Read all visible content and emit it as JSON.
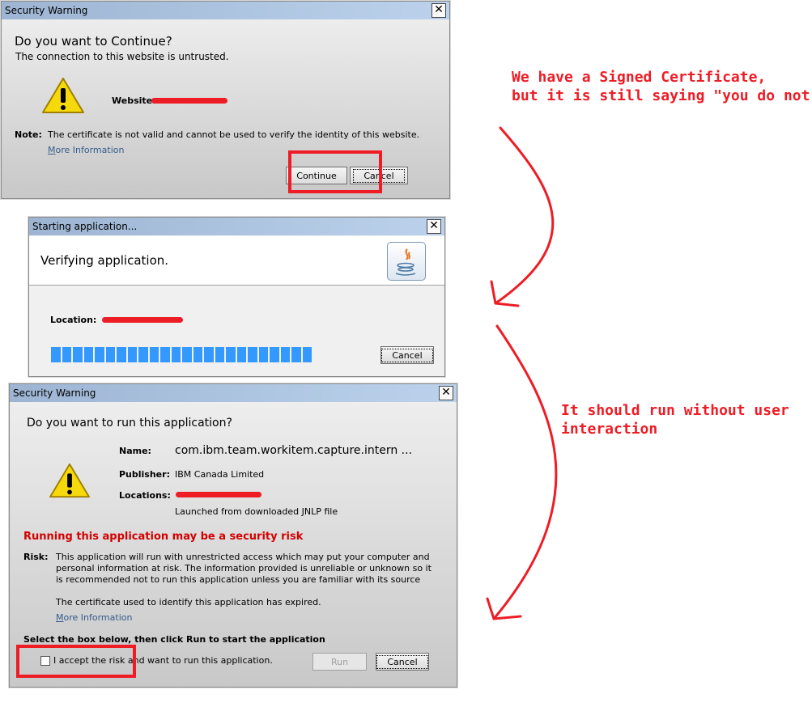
{
  "dialog1": {
    "title": "Security Warning",
    "heading": "Do you want to Continue?",
    "subheading": "The connection to this website is untrusted.",
    "website_label": "Website:",
    "note_label": "Note:",
    "note_text": "The certificate is not valid and cannot be used to verify the identity of this website.",
    "more_info": "More Information",
    "continue_label": "Continue",
    "cancel_label": "Cancel",
    "close_label": "✕"
  },
  "dialog2": {
    "title": "Starting application...",
    "heading": "Verifying application.",
    "location_label": "Location:",
    "cancel_label": "Cancel",
    "close_label": "✕",
    "progress_color": "#3399ff"
  },
  "dialog3": {
    "title": "Security Warning",
    "heading": "Do you want to run this application?",
    "name_label": "Name:",
    "name_value": "com.ibm.team.workitem.capture.intern ...",
    "publisher_label": "Publisher:",
    "publisher_value": "IBM Canada Limited",
    "locations_label": "Locations:",
    "launched_from": "Launched from downloaded JNLP file",
    "risk_heading": "Running this application may be a security risk",
    "risk_label": "Risk:",
    "risk_text": "This application will run with unrestricted access which may put your computer and personal information at risk. The information provided is unreliable or unknown so it is recommended not to run this application unless you are familiar with its source",
    "cert_expired": "The certificate used to identify this application has expired.",
    "more_info": "More Information",
    "select_instruction": "Select the box below, then click Run to start the application",
    "accept_label": "I accept the risk and want to run this application.",
    "accept_checked": false,
    "run_label": "Run",
    "cancel_label": "Cancel",
    "close_label": "✕"
  },
  "annotations": {
    "note1": "We have a Signed Certificate,\nbut it is still saying \"you do not",
    "note2": "It should run without user\ninteraction",
    "color": "#ee1c25"
  }
}
